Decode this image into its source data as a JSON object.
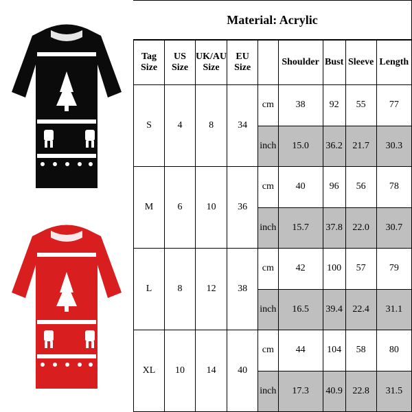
{
  "header": {
    "material_label": "Material: Acrylic"
  },
  "columns": {
    "tag": "Tag Size",
    "us": "US Size",
    "ukau": "UK/AU Size",
    "eu": "EU Size",
    "unit": "",
    "shoulder": "Shoulder",
    "bust": "Bust",
    "sleeve": "Sleeve",
    "length": "Length"
  },
  "units": {
    "cm": "cm",
    "inch": "inch"
  },
  "rows": [
    {
      "tag": "S",
      "us": "4",
      "ukau": "8",
      "eu": "34",
      "cm": {
        "shoulder": "38",
        "bust": "92",
        "sleeve": "55",
        "length": "77"
      },
      "inch": {
        "shoulder": "15.0",
        "bust": "36.2",
        "sleeve": "21.7",
        "length": "30.3"
      }
    },
    {
      "tag": "M",
      "us": "6",
      "ukau": "10",
      "eu": "36",
      "cm": {
        "shoulder": "40",
        "bust": "96",
        "sleeve": "56",
        "length": "78"
      },
      "inch": {
        "shoulder": "15.7",
        "bust": "37.8",
        "sleeve": "22.0",
        "length": "30.7"
      }
    },
    {
      "tag": "L",
      "us": "8",
      "ukau": "12",
      "eu": "38",
      "cm": {
        "shoulder": "42",
        "bust": "100",
        "sleeve": "57",
        "length": "79"
      },
      "inch": {
        "shoulder": "16.5",
        "bust": "39.4",
        "sleeve": "22.4",
        "length": "31.1"
      }
    },
    {
      "tag": "XL",
      "us": "10",
      "ukau": "14",
      "eu": "40",
      "cm": {
        "shoulder": "44",
        "bust": "104",
        "sleeve": "58",
        "length": "80"
      },
      "inch": {
        "shoulder": "17.3",
        "bust": "40.9",
        "sleeve": "22.8",
        "length": "31.5"
      }
    }
  ],
  "product_images": [
    {
      "name": "black-christmas-sweater",
      "base_color": "#0b0b0b",
      "accent_color": "#ffffff"
    },
    {
      "name": "red-christmas-sweater",
      "base_color": "#d81e1e",
      "accent_color": "#ffffff"
    }
  ]
}
